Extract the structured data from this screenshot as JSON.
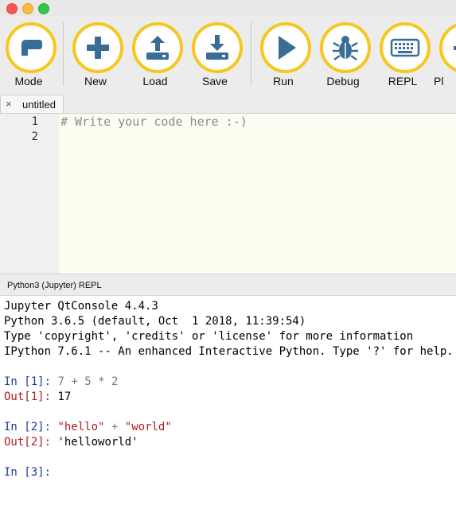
{
  "toolbar": {
    "buttons": [
      {
        "label": "Mode"
      },
      {
        "label": "New"
      },
      {
        "label": "Load"
      },
      {
        "label": "Save"
      },
      {
        "label": "Run"
      },
      {
        "label": "Debug"
      },
      {
        "label": "REPL"
      },
      {
        "label": "Pl"
      }
    ],
    "accent_color": "#f5c71f",
    "icon_color": "#3a6d95"
  },
  "tabs": [
    {
      "label": "untitled",
      "close_glyph": "×"
    }
  ],
  "editor": {
    "line_numbers": [
      "1",
      "2"
    ],
    "code_comment": "# Write your code here :-)"
  },
  "repl": {
    "title": "Python3 (Jupyter) REPL",
    "banner": [
      "Jupyter QtConsole 4.4.3",
      "Python 3.6.5 (default, Oct  1 2018, 11:39:54)",
      "Type 'copyright', 'credits' or 'license' for more information",
      "IPython 7.6.1 -- An enhanced Interactive Python. Type '?' for help."
    ],
    "cells": [
      {
        "in_prompt": "In [1]:",
        "input_a": "7",
        "input_op1": "+",
        "input_b": "5",
        "input_op2": "*",
        "input_c": "2",
        "out_prompt": "Out[1]:",
        "output": "17"
      },
      {
        "in_prompt": "In [2]:",
        "input_a": "\"hello\"",
        "input_op1": "+",
        "input_b": "\"world\"",
        "out_prompt": "Out[2]:",
        "output": "'helloworld'"
      },
      {
        "in_prompt": "In [3]:"
      }
    ]
  }
}
